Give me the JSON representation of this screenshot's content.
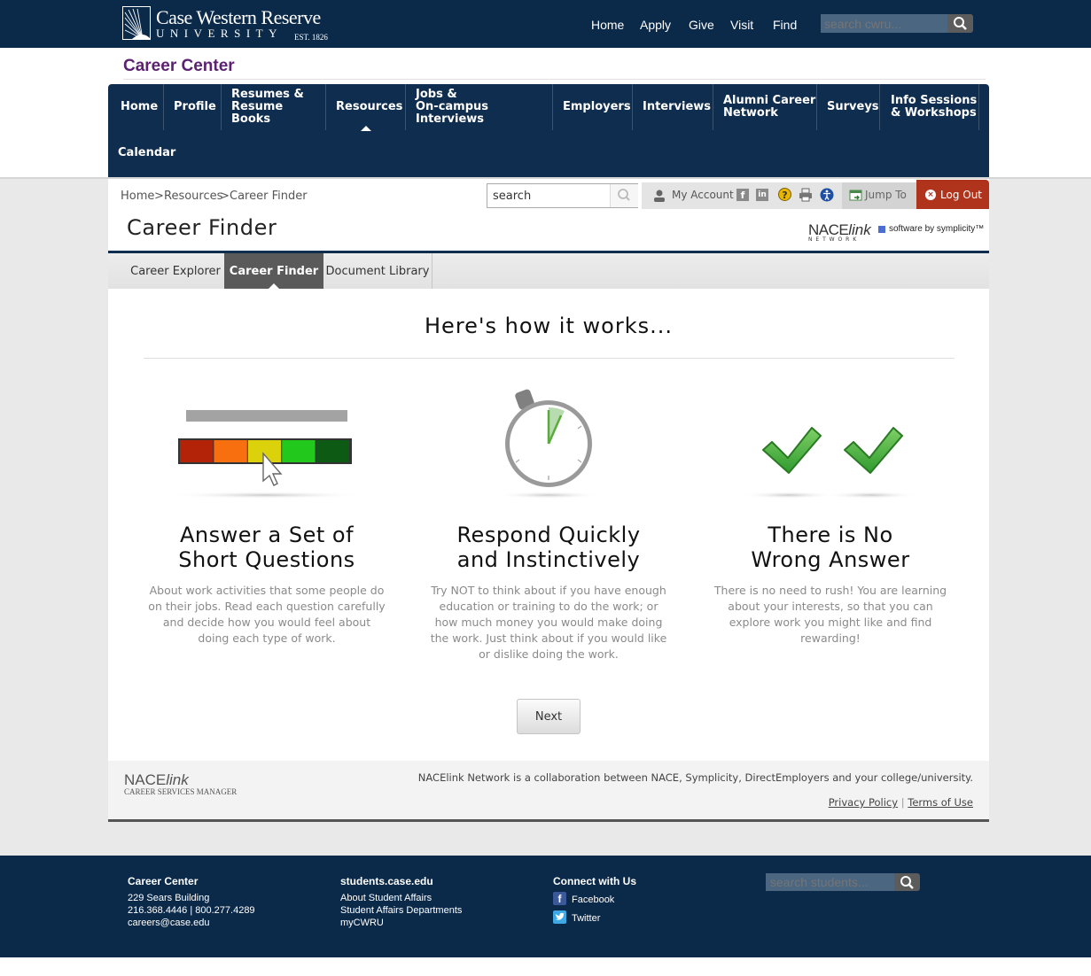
{
  "university": {
    "name_line1": "Case Western Reserve",
    "name_line2": "UNIVERSITY",
    "est": "EST. 1826",
    "nav": [
      "Home",
      "Apply",
      "Give",
      "Visit",
      "Find"
    ],
    "search_placeholder": "search cwru..."
  },
  "site_title": "Career Center",
  "main_nav": [
    {
      "label_lines": [
        "Home"
      ]
    },
    {
      "label_lines": [
        "Profile"
      ]
    },
    {
      "label_lines": [
        "Resumes &",
        "Resume Books"
      ]
    },
    {
      "label_lines": [
        "Resources"
      ],
      "active": true
    },
    {
      "label_lines": [
        "Jobs &",
        "On-campus Interviews"
      ]
    },
    {
      "label_lines": [
        "Employers"
      ]
    },
    {
      "label_lines": [
        "Interviews"
      ]
    },
    {
      "label_lines": [
        "Alumni Career",
        "Network"
      ]
    },
    {
      "label_lines": [
        "Surveys"
      ]
    },
    {
      "label_lines": [
        "Info Sessions",
        "& Workshops"
      ]
    },
    {
      "label_lines": [
        "Calendar"
      ]
    }
  ],
  "breadcrumb": {
    "home": "Home",
    "sep": ">",
    "resources": "Resources",
    "current": "Career Finder"
  },
  "sub_search_value": "search",
  "toolbar": {
    "my_account": "My Account",
    "jump_to": "Jump To",
    "log_out": "Log Out"
  },
  "page_title": "Career Finder",
  "branding": {
    "nace": "NACE",
    "link": "link",
    "network": "N E T W O R K",
    "symplicity": "software by symplicity™"
  },
  "tabs": [
    "Career Explorer",
    "Career Finder",
    "Document Library"
  ],
  "how_title": "Here's how it works...",
  "columns": [
    {
      "title_lines": [
        "Answer a Set of",
        "Short Questions"
      ],
      "desc": "About work activities that some people do on their jobs. Read each question carefully and decide how you would feel about doing each type of work."
    },
    {
      "title_lines": [
        "Respond Quickly",
        "and Instinctively"
      ],
      "desc": "Try NOT to think about if you have enough education or training to do the work; or how much money you would make doing the work. Just think about if you would like or dislike doing the work."
    },
    {
      "title_lines": [
        "There is No",
        "Wrong Answer"
      ],
      "desc": "There is no need to rush! You are learning about your interests, so that you can explore work you might like and find rewarding!"
    }
  ],
  "scale_colors": [
    "#b32308",
    "#f76f0e",
    "#dcd20c",
    "#22c91c",
    "#0d5a14"
  ],
  "next_label": "Next",
  "footer_inner": {
    "logo_nace": "NACE",
    "logo_link": "link",
    "logo_sub": "CAREER SERVICES MANAGER",
    "collab": "NACElink Network is a collaboration between NACE, Symplicity, DirectEmployers and your college/university.",
    "privacy": "Privacy Policy",
    "sep": "|",
    "terms": "Terms of Use"
  },
  "footer": {
    "col1": {
      "title": "Career Center",
      "lines": [
        "229 Sears Building",
        "216.368.4446 | 800.277.4289",
        "careers@case.edu"
      ]
    },
    "col2": {
      "title": "students.case.edu",
      "lines": [
        "About Student Affairs",
        "Student Affairs Departments",
        "myCWRU"
      ]
    },
    "col3": {
      "title": "Connect with Us",
      "facebook": "Facebook",
      "twitter": "Twitter"
    },
    "search_placeholder": "search students..."
  }
}
